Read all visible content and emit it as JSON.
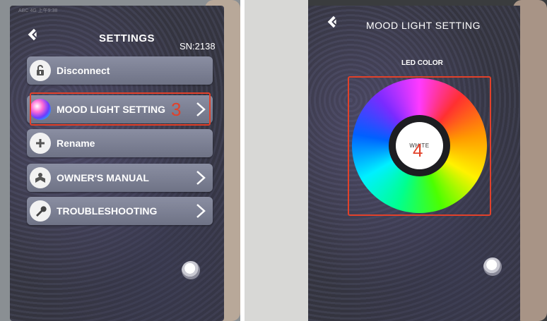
{
  "left_screen": {
    "status_text": "ABC 4G   上午9:38",
    "title": "SETTINGS",
    "serial": "SN:2138",
    "menu": [
      {
        "label": "Disconnect",
        "icon": "lock-open-icon",
        "has_chevron": false
      },
      {
        "label": "MOOD LIGHT SETTING",
        "icon": "color-ball-icon",
        "has_chevron": true
      },
      {
        "label": "Rename",
        "icon": "plus-icon",
        "has_chevron": false
      },
      {
        "label": "OWNER'S MANUAL",
        "icon": "manual-icon",
        "has_chevron": true
      },
      {
        "label": "TROUBLESHOOTING",
        "icon": "wrench-icon",
        "has_chevron": true
      }
    ],
    "annotation": "3"
  },
  "right_screen": {
    "title": "MOOD LIGHT SETTING",
    "led_label": "LED COLOR",
    "center_label": "WHITE",
    "annotation": "4"
  },
  "colors": {
    "annotation": "#e2412a",
    "menu_bg": "#7b7f93",
    "screen_bg": "#36374a"
  }
}
